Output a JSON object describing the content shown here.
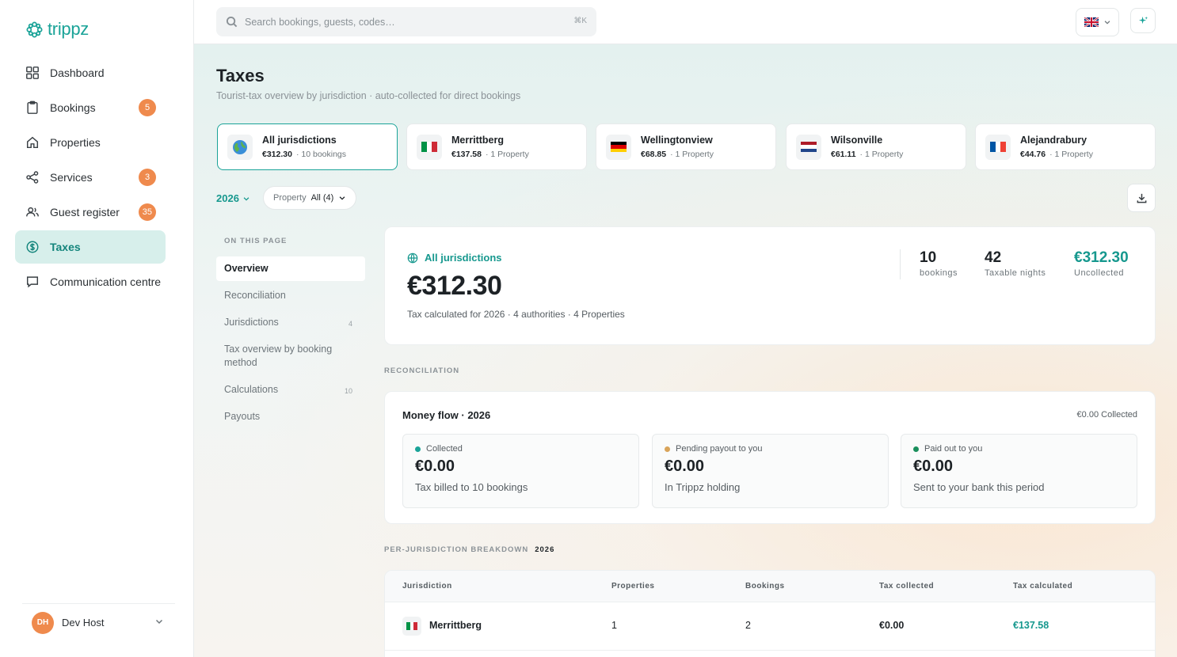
{
  "app": {
    "name": "trippz"
  },
  "nav": [
    {
      "label": "Dashboard",
      "icon": "grid-icon",
      "badge": null
    },
    {
      "label": "Bookings",
      "icon": "clipboard-icon",
      "badge": "5"
    },
    {
      "label": "Properties",
      "icon": "home-icon",
      "badge": null
    },
    {
      "label": "Services",
      "icon": "share-icon",
      "badge": "3"
    },
    {
      "label": "Guest register",
      "icon": "users-icon",
      "badge": "35"
    },
    {
      "label": "Taxes",
      "icon": "tax-icon",
      "badge": null,
      "active": true
    },
    {
      "label": "Communication centre",
      "icon": "chat-icon",
      "badge": null
    }
  ],
  "user": {
    "initials": "DH",
    "name": "Dev Host"
  },
  "topbar": {
    "search_placeholder": "Search bookings, guests, codes…",
    "shortcut": "⌘K",
    "language": "en-GB"
  },
  "page": {
    "title": "Taxes",
    "subtitle": "Tourist-tax overview by jurisdiction · auto-collected for direct bookings"
  },
  "jurisdictions": [
    {
      "name": "All jurisdictions",
      "amount": "€312.30",
      "meta": "· 10 bookings",
      "flag": "globe",
      "active": true
    },
    {
      "name": "Merrittberg",
      "amount": "€137.58",
      "meta": "· 1 Property",
      "flag": "it"
    },
    {
      "name": "Wellingtonview",
      "amount": "€68.85",
      "meta": "· 1 Property",
      "flag": "de"
    },
    {
      "name": "Wilsonville",
      "amount": "€61.11",
      "meta": "· 1 Property",
      "flag": "nl"
    },
    {
      "name": "Alejandrabury",
      "amount": "€44.76",
      "meta": "· 1 Property",
      "flag": "fr"
    }
  ],
  "filters": {
    "year": "2026",
    "property_label": "Property",
    "property_value": "All (4)"
  },
  "toc": {
    "heading": "ON THIS PAGE",
    "items": [
      {
        "label": "Overview",
        "count": "",
        "active": true
      },
      {
        "label": "Reconciliation",
        "count": ""
      },
      {
        "label": "Jurisdictions",
        "count": "4"
      },
      {
        "label": "Tax overview by booking method",
        "count": ""
      },
      {
        "label": "Calculations",
        "count": "10"
      },
      {
        "label": "Payouts",
        "count": ""
      }
    ]
  },
  "overview": {
    "label": "All jurisdictions",
    "amount": "€312.30",
    "description": "Tax calculated for 2026 · 4 authorities · 4 Properties",
    "stats": [
      {
        "value": "10",
        "label": "bookings"
      },
      {
        "value": "42",
        "label": "Taxable nights"
      },
      {
        "value": "€312.30",
        "label": "Uncollected"
      }
    ]
  },
  "reconciliation": {
    "heading": "RECONCILIATION",
    "title": "Money flow · 2026",
    "summary": "€0.00 Collected",
    "flows": [
      {
        "label": "Collected",
        "amount": "€0.00",
        "sub": "Tax billed to 10 bookings",
        "color": "#1aa398"
      },
      {
        "label": "Pending payout to you",
        "amount": "€0.00",
        "sub": "In Trippz holding",
        "color": "#d9a45a"
      },
      {
        "label": "Paid out to you",
        "amount": "€0.00",
        "sub": "Sent to your bank this period",
        "color": "#1a8f5c"
      }
    ]
  },
  "breakdown": {
    "heading": "PER-JURISDICTION BREAKDOWN",
    "year": "2026",
    "columns": [
      "Jurisdiction",
      "Properties",
      "Bookings",
      "Tax collected",
      "Tax calculated"
    ],
    "rows": [
      {
        "jurisdiction": "Merrittberg",
        "flag": "it",
        "properties": "1",
        "bookings": "2",
        "collected": "€0.00",
        "calculated": "€137.58"
      }
    ]
  }
}
